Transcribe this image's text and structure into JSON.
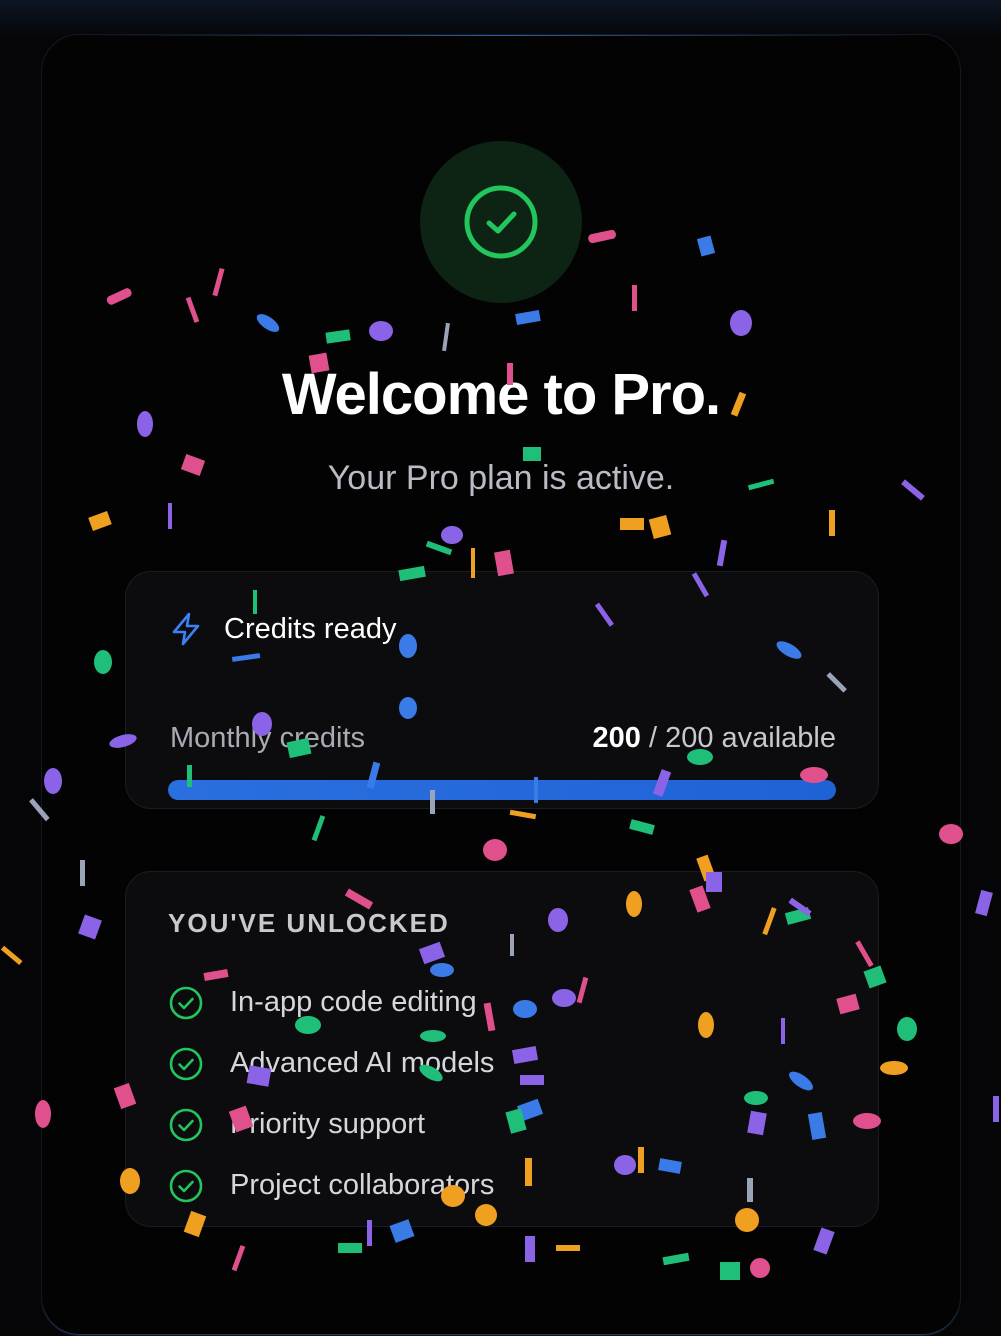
{
  "modal": {
    "title": "Welcome to Pro.",
    "subtitle": "Your Pro plan is active."
  },
  "credits": {
    "icon": "lightning-icon",
    "title": "Credits ready",
    "label": "Monthly credits",
    "available": "200",
    "separator": "/",
    "total_text": "200 available",
    "fill_fraction": 1.0
  },
  "unlocked": {
    "heading": "YOU'VE UNLOCKED",
    "items": [
      {
        "label": "In-app code editing"
      },
      {
        "label": "Advanced AI models"
      },
      {
        "label": "Priority support"
      },
      {
        "label": "Project collaborators"
      }
    ]
  },
  "colors": {
    "background": "#050507",
    "success": "#22c55e",
    "accent": "#2a6fe0"
  }
}
